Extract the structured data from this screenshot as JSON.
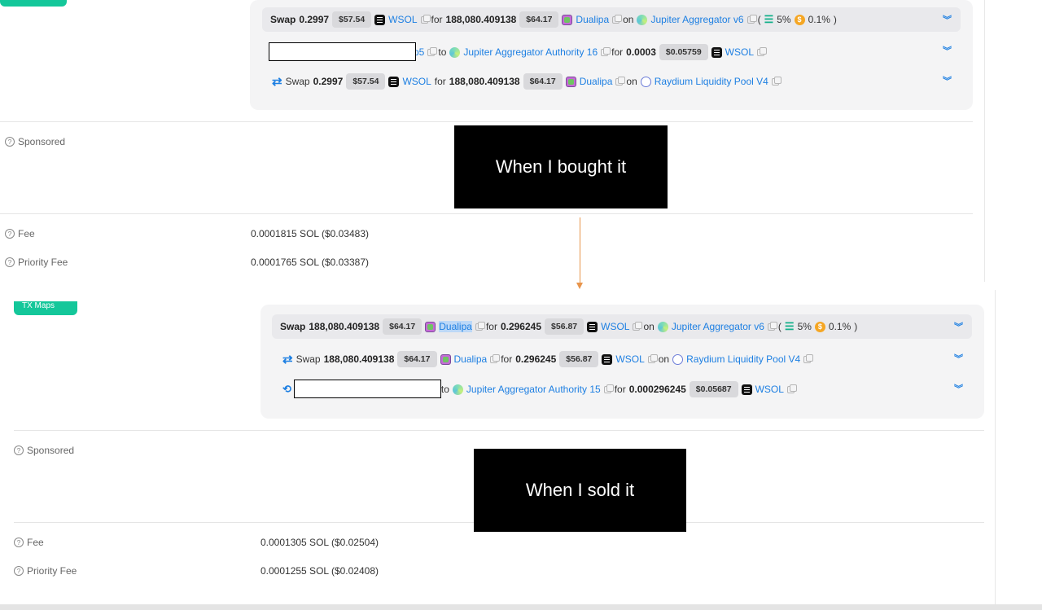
{
  "bought": {
    "pill": "",
    "main": {
      "swap": "Swap",
      "amount_in": "0.2997",
      "usd_in": "$57.54",
      "token_in": "WSOL",
      "for": "for",
      "amount_out": "188,080.409138",
      "usd_out": "$64.17",
      "token_out": "Dualipa",
      "on": "on",
      "dex": "Jupiter Aggregator v6",
      "paren_open": "(",
      "slippage": "5%",
      "fee_pct": "0.1%",
      "paren_close": ")"
    },
    "transfer": {
      "addr_tail": "p5",
      "to": "to",
      "dest": "Jupiter Aggregator Authority 16",
      "for": "for",
      "amount": "0.0003",
      "usd": "$0.05759",
      "token": "WSOL"
    },
    "route": {
      "swap": "Swap",
      "amount_in": "0.2997",
      "usd_in": "$57.54",
      "token_in": "WSOL",
      "for": "for",
      "amount_out": "188,080.409138",
      "usd_out": "$64.17",
      "token_out": "Dualipa",
      "on": "on",
      "pool": "Raydium Liquidity Pool V4"
    },
    "sponsored": "Sponsored",
    "fee_label": "Fee",
    "fee_value": "0.0001815 SOL ($0.03483)",
    "priority_label": "Priority Fee",
    "priority_value": "0.0001765 SOL ($0.03387)",
    "banner": "When I bought it"
  },
  "sold": {
    "pill": "TX Maps",
    "main": {
      "swap": "Swap",
      "amount_in": "188,080.409138",
      "usd_in": "$64.17",
      "token_in": "Dualipa",
      "for": "for",
      "amount_out": "0.296245",
      "usd_out": "$56.87",
      "token_out": "WSOL",
      "on": "on",
      "dex": "Jupiter Aggregator v6",
      "paren_open": "(",
      "slippage": "5%",
      "fee_pct": "0.1%",
      "paren_close": ")"
    },
    "route": {
      "swap": "Swap",
      "amount_in": "188,080.409138",
      "usd_in": "$64.17",
      "token_in": "Dualipa",
      "for": "for",
      "amount_out": "0.296245",
      "usd_out": "$56.87",
      "token_out": "WSOL",
      "on": "on",
      "pool": "Raydium Liquidity Pool V4"
    },
    "transfer": {
      "to": "to",
      "dest": "Jupiter Aggregator Authority 15",
      "for": "for",
      "amount": "0.000296245",
      "usd": "$0.05687",
      "token": "WSOL"
    },
    "sponsored": "Sponsored",
    "fee_label": "Fee",
    "fee_value": "0.0001305 SOL ($0.02504)",
    "priority_label": "Priority Fee",
    "priority_value": "0.0001255 SOL ($0.02408)",
    "banner": "When I sold it"
  },
  "icons": {
    "copy": "copy-icon",
    "expand": "chevron-double-down-icon",
    "swap": "swap-arrows-icon",
    "help": "question-circle-icon",
    "slippage": "sliders-icon",
    "fee": "dollar-coin-icon"
  },
  "colors": {
    "link": "#1d7fe2",
    "accent": "#14c79a",
    "arrow": "#e8954c"
  }
}
